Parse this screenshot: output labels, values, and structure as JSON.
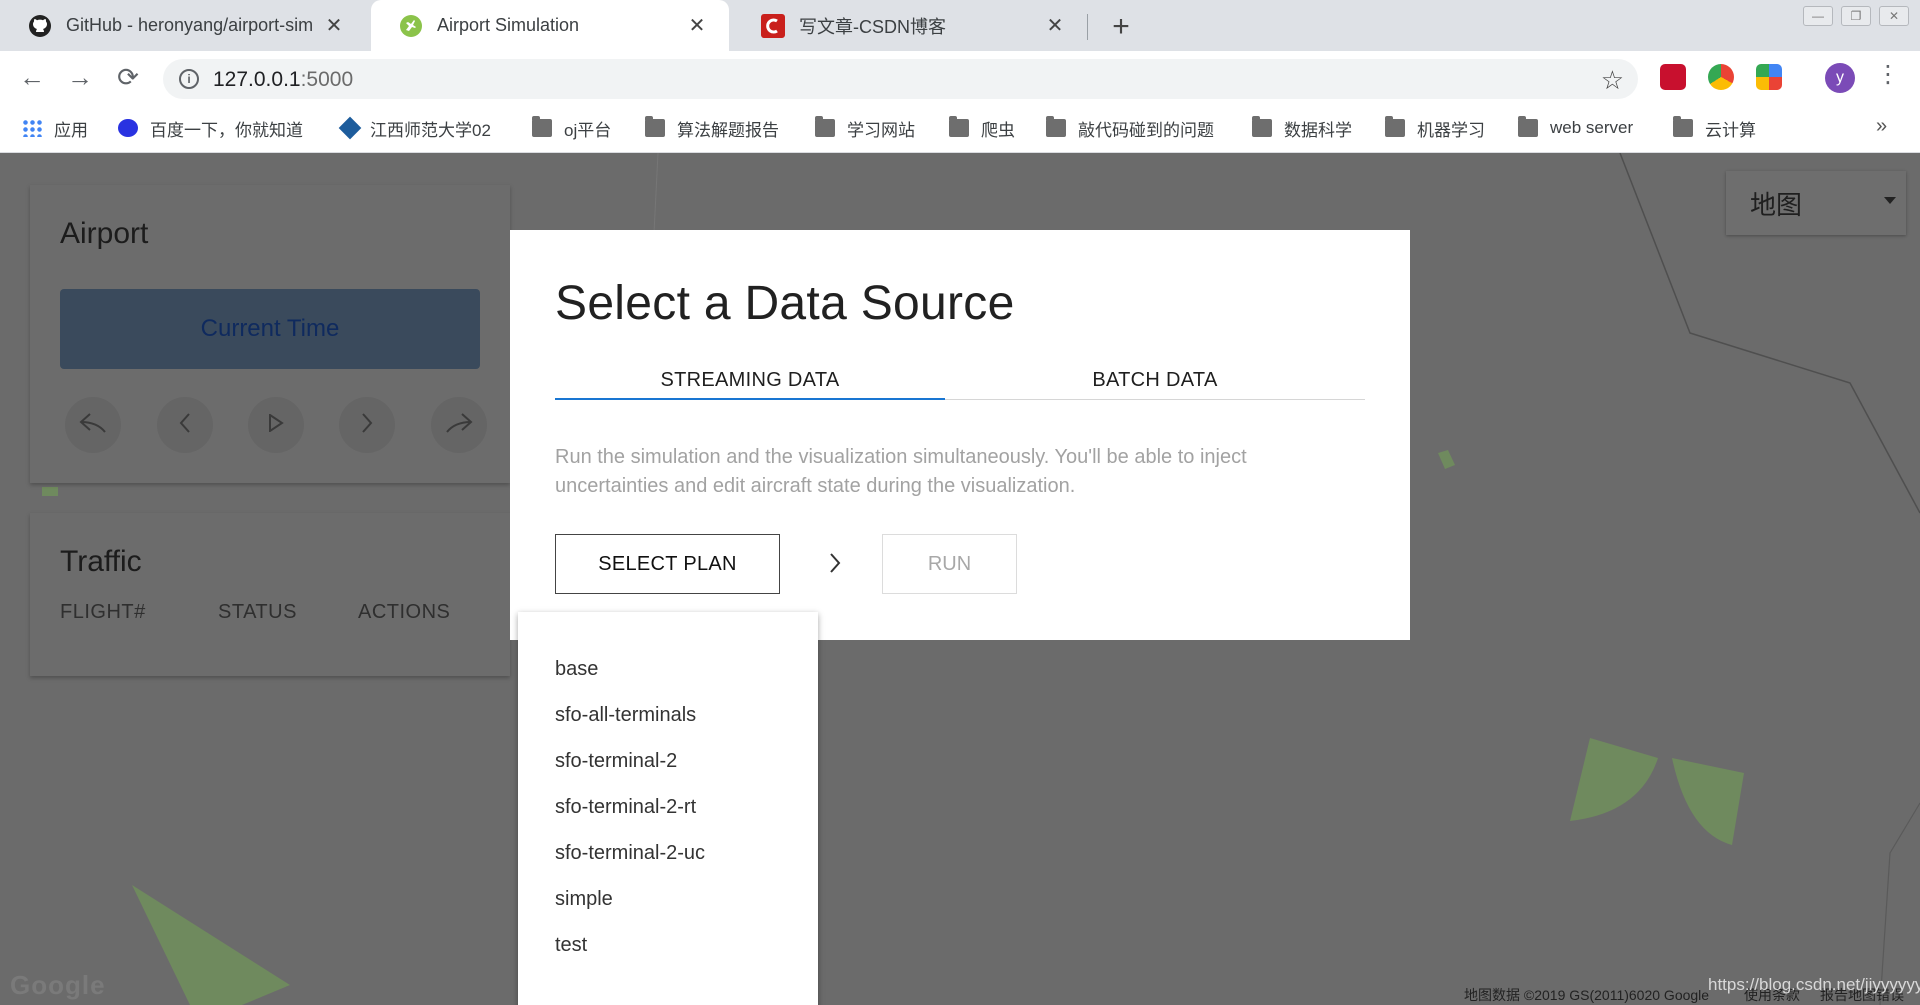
{
  "browser": {
    "tabs": [
      {
        "title": "GitHub - heronyang/airport-sim",
        "active": false
      },
      {
        "title": "Airport Simulation",
        "active": true
      },
      {
        "title": "写文章-CSDN博客",
        "active": false
      }
    ],
    "url_host": "127.0.0.1",
    "url_port": ":5000",
    "profile_initial": "y",
    "bookmarks": [
      "应用",
      "百度一下，你就知道",
      "江西师范大学02",
      "oj平台",
      "算法解题报告",
      "学习网站",
      "爬虫",
      "敲代码碰到的问题",
      "数据科学",
      "机器学习",
      "web server",
      "云计算"
    ]
  },
  "map": {
    "type_label": "地图",
    "logo": "Google",
    "attribution": "地图数据 ©2019 GS(2011)6020 Google",
    "terms": "使用条款",
    "report": "报告地图错误",
    "watermark": "https://blog.csdn.net/jiyyyyyy"
  },
  "airport_panel": {
    "title": "Airport",
    "current_time_label": "Current Time"
  },
  "traffic_panel": {
    "title": "Traffic",
    "columns": [
      "FLIGHT#",
      "STATUS",
      "ACTIONS"
    ]
  },
  "modal": {
    "title": "Select a Data Source",
    "tabs": [
      {
        "label": "STREAMING DATA",
        "active": true
      },
      {
        "label": "BATCH DATA",
        "active": false
      }
    ],
    "description": "Run the simulation and the visualization simultaneously. You'll be able to inject uncertainties and edit aircraft state during the visualization.",
    "select_plan_label": "SELECT PLAN",
    "run_label": "RUN"
  },
  "plan_options": [
    "base",
    "sfo-all-terminals",
    "sfo-terminal-2",
    "sfo-terminal-2-rt",
    "sfo-terminal-2-uc",
    "simple",
    "test"
  ],
  "colors": {
    "accent": "#1976d2",
    "overlay": "#6b6b6b",
    "map_green": "#6f8a5e"
  }
}
